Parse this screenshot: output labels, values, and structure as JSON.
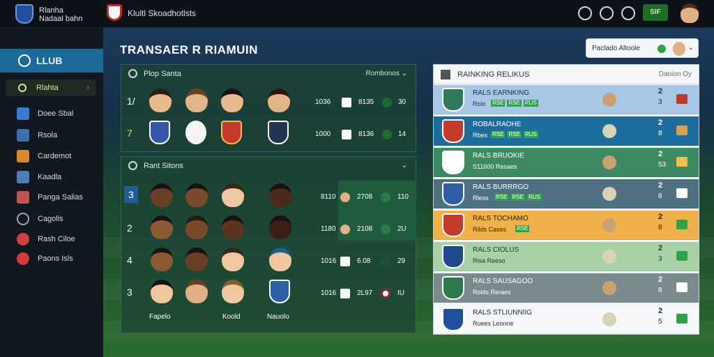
{
  "topbar": {
    "brand_line1": "Rlanha",
    "brand_line2": "Nadaal bahn",
    "app_title": "Klultl Skoadhotlsts",
    "badge_label": "SIF"
  },
  "sidebar": {
    "club_label": "LLUB",
    "search_label": "Rlahta",
    "items": [
      {
        "label": "Doee Sbal",
        "color": "#3a7bd5"
      },
      {
        "label": "Rsola",
        "color": "#3a6fb0"
      },
      {
        "label": "Cardemot",
        "color": "#d9892a"
      },
      {
        "label": "Kaadla",
        "color": "#4f7db8"
      },
      {
        "label": "Panga Salias",
        "color": "#c05555"
      },
      {
        "label": "Cagolls",
        "color": "#9aa6b2"
      },
      {
        "label": "Rash Ciloe",
        "color": "#d04040"
      },
      {
        "label": "Paons Isls",
        "color": "#d53a3a"
      }
    ]
  },
  "main": {
    "heading": "TRANSAER R RIAMUIN"
  },
  "players_panel": {
    "title": "Plop Santa",
    "meta": "Rombonos  ⌄",
    "rows": [
      {
        "num": "1/",
        "v1": "1036",
        "v2": "8135",
        "v3": "30"
      },
      {
        "num": "7",
        "v1": "1000",
        "v2": "8136",
        "v3": "14"
      }
    ]
  },
  "squad_panel": {
    "title": "Rant Sitons",
    "rows": [
      {
        "num": "3",
        "v1": "8110",
        "v2": "2708",
        "v3": "110"
      },
      {
        "num": "2",
        "v1": "1180",
        "v2": "2108",
        "v3": "2U"
      },
      {
        "num": "4",
        "v1": "1016",
        "v2": "6.08",
        "v3": "29"
      },
      {
        "num": "3",
        "v1": "1016",
        "v2": "2L97",
        "v3": "IU"
      }
    ],
    "footer": [
      "Fapelo",
      "Koold",
      "Nauolo"
    ]
  },
  "ranking": {
    "title": "RAINKING RELIKUS",
    "meta": "Daoion  Oy",
    "selector_label": "Paclado Altoole",
    "rows": [
      {
        "name": "RALS EARNKING",
        "sub": "Rolo",
        "tags": [
          "RSE",
          "RSE",
          "RUS"
        ],
        "rank": "2",
        "rank2": "3",
        "bg": "#a8c7e6",
        "text": "#10324f",
        "crest": "#2f7a5a"
      },
      {
        "name": "ROBALRAOHE",
        "sub": "Rbes",
        "tags": [
          "RSE",
          "RSE",
          "RUS"
        ],
        "rank": "2",
        "rank2": "8",
        "bg": "#1e6d9f",
        "text": "#ffffff",
        "crest": "#c43b2e"
      },
      {
        "name": "RALS BRUOKIE",
        "sub": "S11600 Resaes",
        "tags": [],
        "rank": "2",
        "rank2": "53",
        "bg": "#3d8a62",
        "text": "#ffffff",
        "crest": "#ffffff"
      },
      {
        "name": "RALS BURRRGO",
        "sub": "Rless",
        "tags": [
          "RSE",
          "RSE",
          "RUS"
        ],
        "rank": "2",
        "rank2": "8",
        "bg": "#4f6f82",
        "text": "#ffffff",
        "crest": "#2b5fa8"
      },
      {
        "name": "RALS TOCHAMO",
        "sub": "Rilds Cases",
        "tags": [
          "RSE"
        ],
        "rank": "2",
        "rank2": "8",
        "bg": "#f0b04a",
        "text": "#2a1d08",
        "crest": "#c43b2e"
      },
      {
        "name": "RALS CIOLUS",
        "sub": "Risa Reeso",
        "tags": [],
        "rank": "2",
        "rank2": "3",
        "bg": "#a9d1a8",
        "text": "#153d1f",
        "crest": "#1f4b8c"
      },
      {
        "name": "RALS SAUSAGOO",
        "sub": "Rolds Reraes",
        "tags": [],
        "rank": "2",
        "rank2": "8",
        "bg": "#7a8a8e",
        "text": "#ffffff",
        "crest": "#2f7a4a"
      },
      {
        "name": "RALS STLIUNNIIG",
        "sub": "Ruees Leonne",
        "tags": [],
        "rank": "2",
        "rank2": "5",
        "bg": "#f7f8fa",
        "text": "#1f2a36",
        "crest": "#1f4f9e"
      }
    ]
  },
  "colors": {
    "accent": "#1d6a98",
    "green": "#2fa24a"
  }
}
